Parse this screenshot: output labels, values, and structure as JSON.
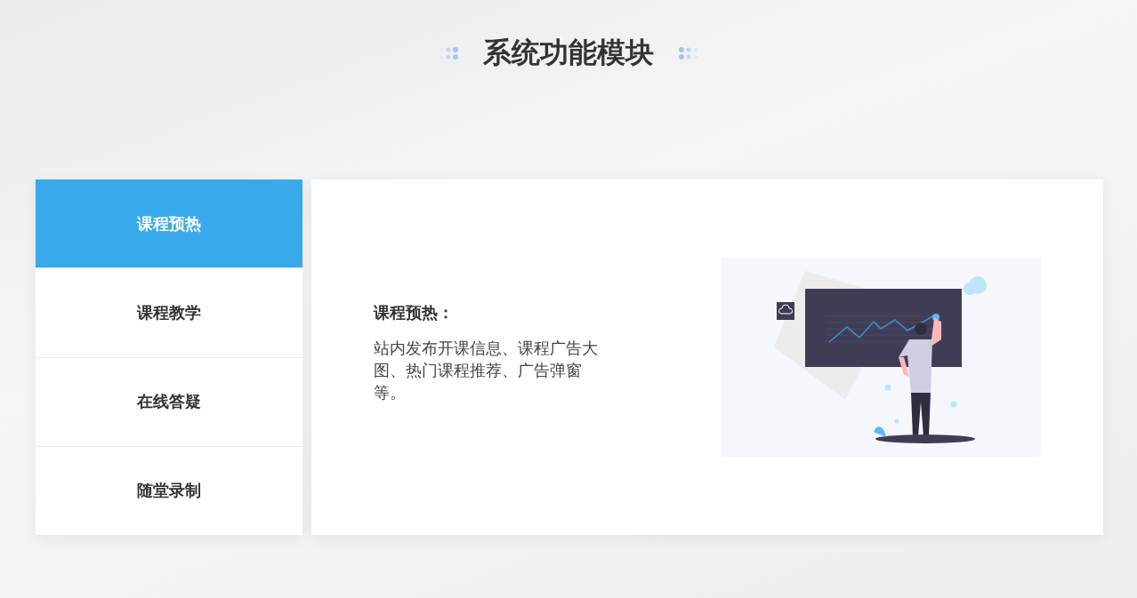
{
  "section_title": "系统功能模块",
  "tabs": [
    {
      "label": "课程预热",
      "selected": true
    },
    {
      "label": "课程教学",
      "selected": false
    },
    {
      "label": "在线答疑",
      "selected": false
    },
    {
      "label": "随堂录制",
      "selected": false
    }
  ],
  "content": {
    "heading": "课程预热：",
    "description": "站内发布开课信息、课程广告大图、热门课程推荐、广告弹窗等。"
  }
}
